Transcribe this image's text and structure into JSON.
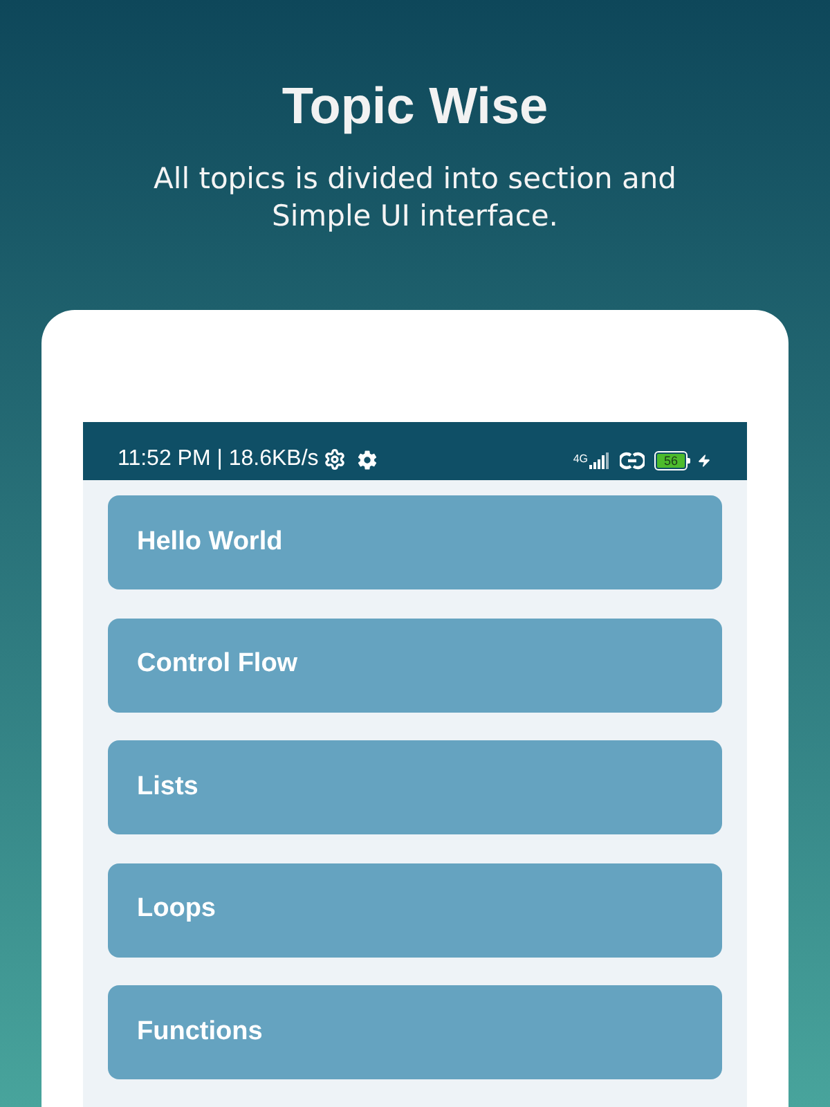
{
  "header": {
    "title": "Topic Wise",
    "subtitle": "All topics is divided into section and Simple UI interface."
  },
  "phone": {
    "status_bar": {
      "time": "11:52 PM | 18.6KB/s",
      "network": "4G",
      "battery": "56"
    },
    "topics": [
      {
        "label": "Hello World"
      },
      {
        "label": "Control Flow"
      },
      {
        "label": "Lists"
      },
      {
        "label": "Loops"
      },
      {
        "label": "Functions"
      }
    ]
  }
}
